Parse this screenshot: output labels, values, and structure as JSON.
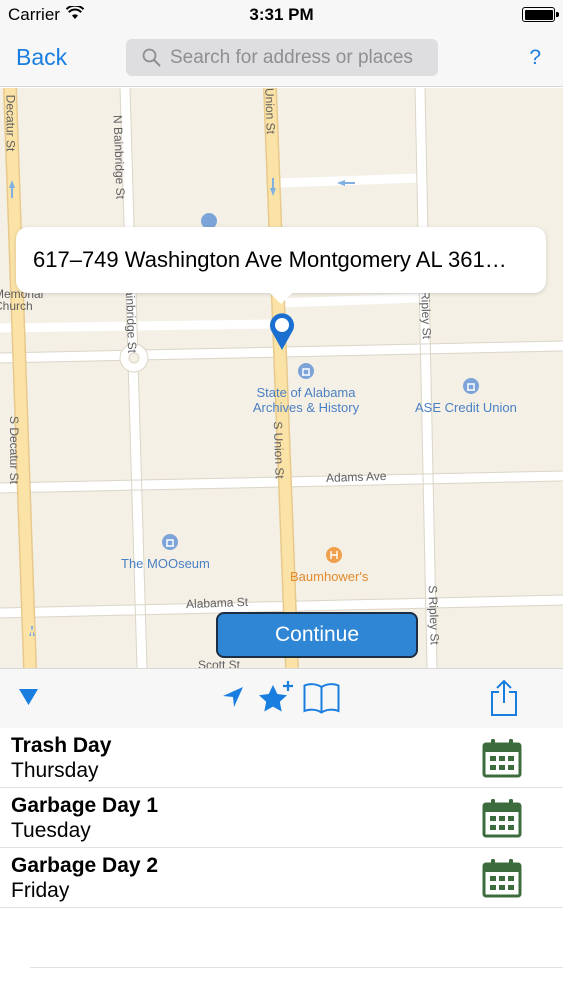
{
  "status_bar": {
    "carrier": "Carrier",
    "time": "3:31 PM"
  },
  "nav_bar": {
    "back_label": "Back",
    "search_placeholder": "Search for address or places",
    "search_value": "",
    "help_label": "?"
  },
  "map": {
    "streets": {
      "decatur_top": "Decatur St",
      "n_bainbridge": "N Bainbridge St",
      "union_top": "Union St",
      "bainbridge_mid": "Bainbridge St",
      "ripley_mid": "Ripley St",
      "s_decatur": "S Decatur St",
      "s_union": "S Union St",
      "adams_ave": "Adams Ave",
      "alabama_st": "Alabama St",
      "s_ripley": "S Ripley St",
      "scott_st": "Scott St"
    },
    "places": {
      "church": "Memorial Church",
      "archives": "State of Alabama Archives & History",
      "ase": "ASE Credit Union",
      "mooseum": "The MOOseum",
      "baumhowers": "Baumhower's"
    },
    "callout_address": "617–749 Washington Ave Montgomery AL 361…",
    "continue_label": "Continue"
  },
  "colors": {
    "accent": "#1a7ee0",
    "continue_button": "#2f86d4",
    "calendar_icon": "#3c6b3e",
    "poi_blue": "#4a80c4",
    "poi_orange": "#e48a2c"
  },
  "toolbar": {
    "icons": [
      "collapse-triangle-icon",
      "location-arrow-icon",
      "add-favorite-star-icon",
      "book-icon",
      "share-icon"
    ]
  },
  "schedule": [
    {
      "title": "Trash Day",
      "day": "Thursday"
    },
    {
      "title": "Garbage Day 1",
      "day": "Tuesday"
    },
    {
      "title": "Garbage Day 2",
      "day": "Friday"
    }
  ]
}
